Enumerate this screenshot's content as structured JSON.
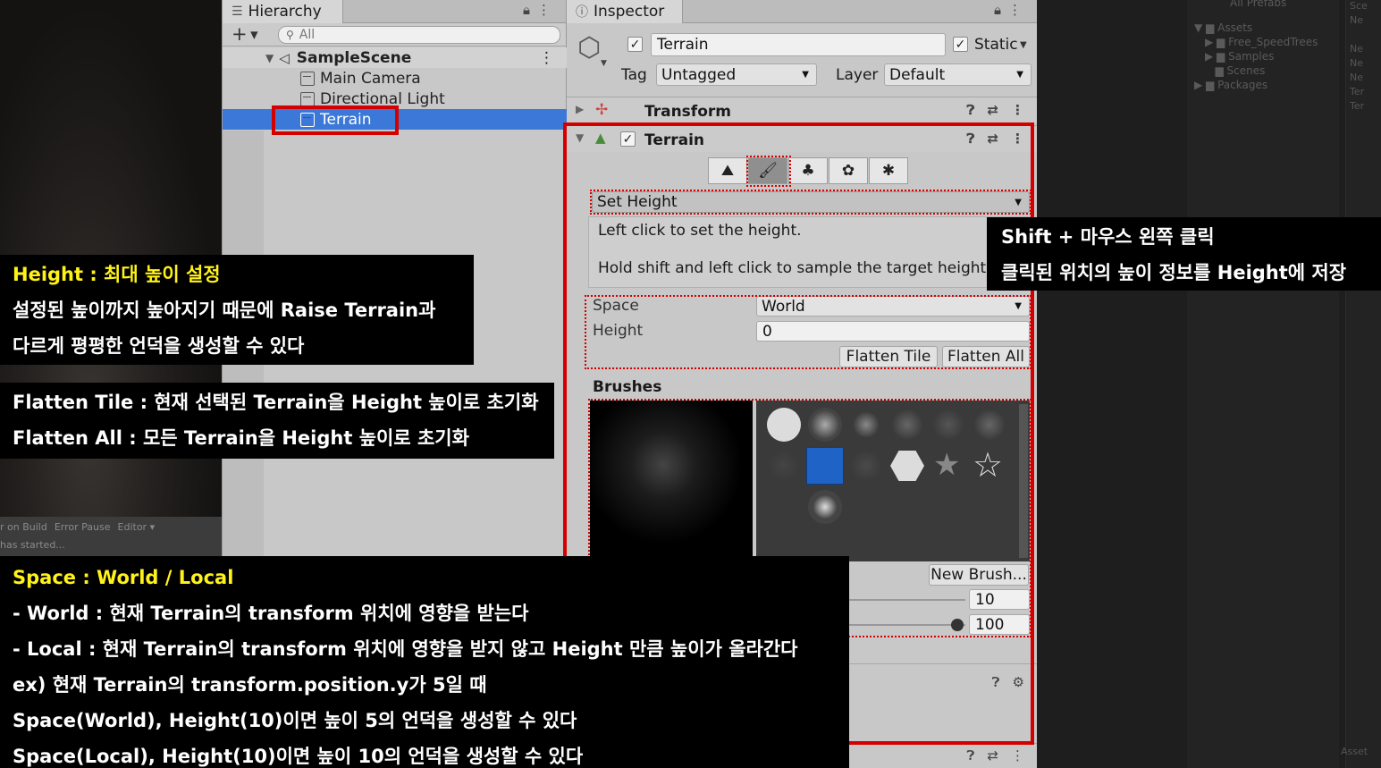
{
  "console": {
    "items": [
      "r on Build",
      "Error Pause",
      "Editor ▾"
    ],
    "status": "has started..."
  },
  "hierarchy": {
    "title": "Hierarchy",
    "search_placeholder": "All",
    "scene": "SampleScene",
    "items": [
      "Main Camera",
      "Directional Light",
      "Terrain"
    ]
  },
  "inspector": {
    "title": "Inspector",
    "object_name": "Terrain",
    "static_label": "Static",
    "tag_label": "Tag",
    "tag_value": "Untagged",
    "layer_label": "Layer",
    "layer_value": "Default",
    "transform_label": "Transform",
    "terrain_label": "Terrain",
    "tool_mode": "Set Height",
    "help_line1": "Left click to set the height.",
    "help_line2": "Hold shift and left click to sample the target height.",
    "space_label": "Space",
    "space_value": "World",
    "height_label": "Height",
    "height_value": "0",
    "flatten_tile": "Flatten Tile",
    "flatten_all": "Flatten All",
    "brushes_label": "Brushes",
    "new_brush": "New Brush...",
    "brush_size_value": "10",
    "opacity_value": "100"
  },
  "project": {
    "items": [
      "All Prefabs",
      "Assets",
      "Free_SpeedTrees",
      "Samples",
      "Scenes",
      "Packages"
    ],
    "side_items": [
      "Sce",
      "Ne",
      "Ne",
      "Ne",
      "Ne",
      "Ter",
      "Ter",
      "Asset"
    ]
  },
  "annotations": {
    "height_title": "Height : 최대 높이 설정",
    "height_line1": "설정된 높이까지 높아지기 때문에 Raise Terrain과",
    "height_line2": "다르게 평평한 언덕을 생성할 수 있다",
    "flatten_tile": "Flatten Tile : 현재 선택된 Terrain을 Height 높이로 초기화",
    "flatten_all": "Flatten All : 모든 Terrain을 Height 높이로 초기화",
    "shift_title": "Shift + 마우스 왼쪽 클릭",
    "shift_line": "클릭된 위치의 높이 정보를 Height에 저장",
    "space_title": "Space : World / Local",
    "space_world": " - World : 현재 Terrain의 transform 위치에 영향을 받는다",
    "space_local": " - Local : 현재 Terrain의 transform 위치에 영향을 받지 않고 Height 만큼 높이가 올라간다",
    "ex_line": "ex) 현재 Terrain의 transform.position.y가 5일 때",
    "ex_world": "Space(World), Height(10)이면 높이 5의 언덕을 생성할 수 있다",
    "ex_local": "Space(Local), Height(10)이면 높이 10의 언덕을 생성할 수 있다"
  },
  "colors": {
    "highlight": "#3c78d8",
    "annotation_red": "#d40000",
    "title_yellow": "#fff21a"
  }
}
